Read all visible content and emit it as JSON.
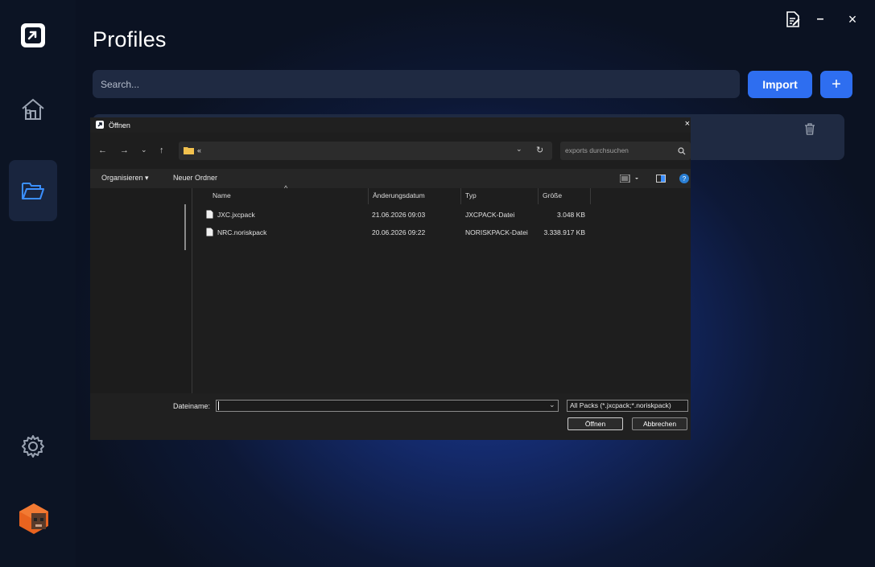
{
  "app": {
    "page_title": "Profiles",
    "search_placeholder": "Search...",
    "import_label": "Import",
    "add_label": "+",
    "minimize_glyph": "–",
    "close_glyph": "×"
  },
  "sidebar": {
    "items": [
      {
        "name": "home",
        "icon": "home-icon",
        "active": false
      },
      {
        "name": "profiles",
        "icon": "folder-open-icon",
        "active": true
      },
      {
        "name": "settings",
        "icon": "gear-icon",
        "active": false
      }
    ],
    "accent": "#2e6ef0"
  },
  "dialog": {
    "title": "Öffnen",
    "close_glyph": "×",
    "address_path": "«",
    "search_placeholder": "exports durchsuchen",
    "organize_label": "Organisieren ▾",
    "new_folder_label": "Neuer Ordner",
    "columns": [
      "Name",
      "Änderungsdatum",
      "Typ",
      "Größe"
    ],
    "files": [
      {
        "name": "JXC.jxcpack",
        "date": "21.06.2026 09:03",
        "type": "JXCPACK-Datei",
        "size": "3.048 KB"
      },
      {
        "name": "NRC.noriskpack",
        "date": "20.06.2026 09:22",
        "type": "NORISKPACK-Datei",
        "size": "3.338.917 KB"
      }
    ],
    "filename_label": "Dateiname:",
    "filename_value": "",
    "filetype_value": "All Packs (*.jxcpack;*.noriskpack)",
    "open_label": "Öffnen",
    "cancel_label": "Abbrechen"
  }
}
